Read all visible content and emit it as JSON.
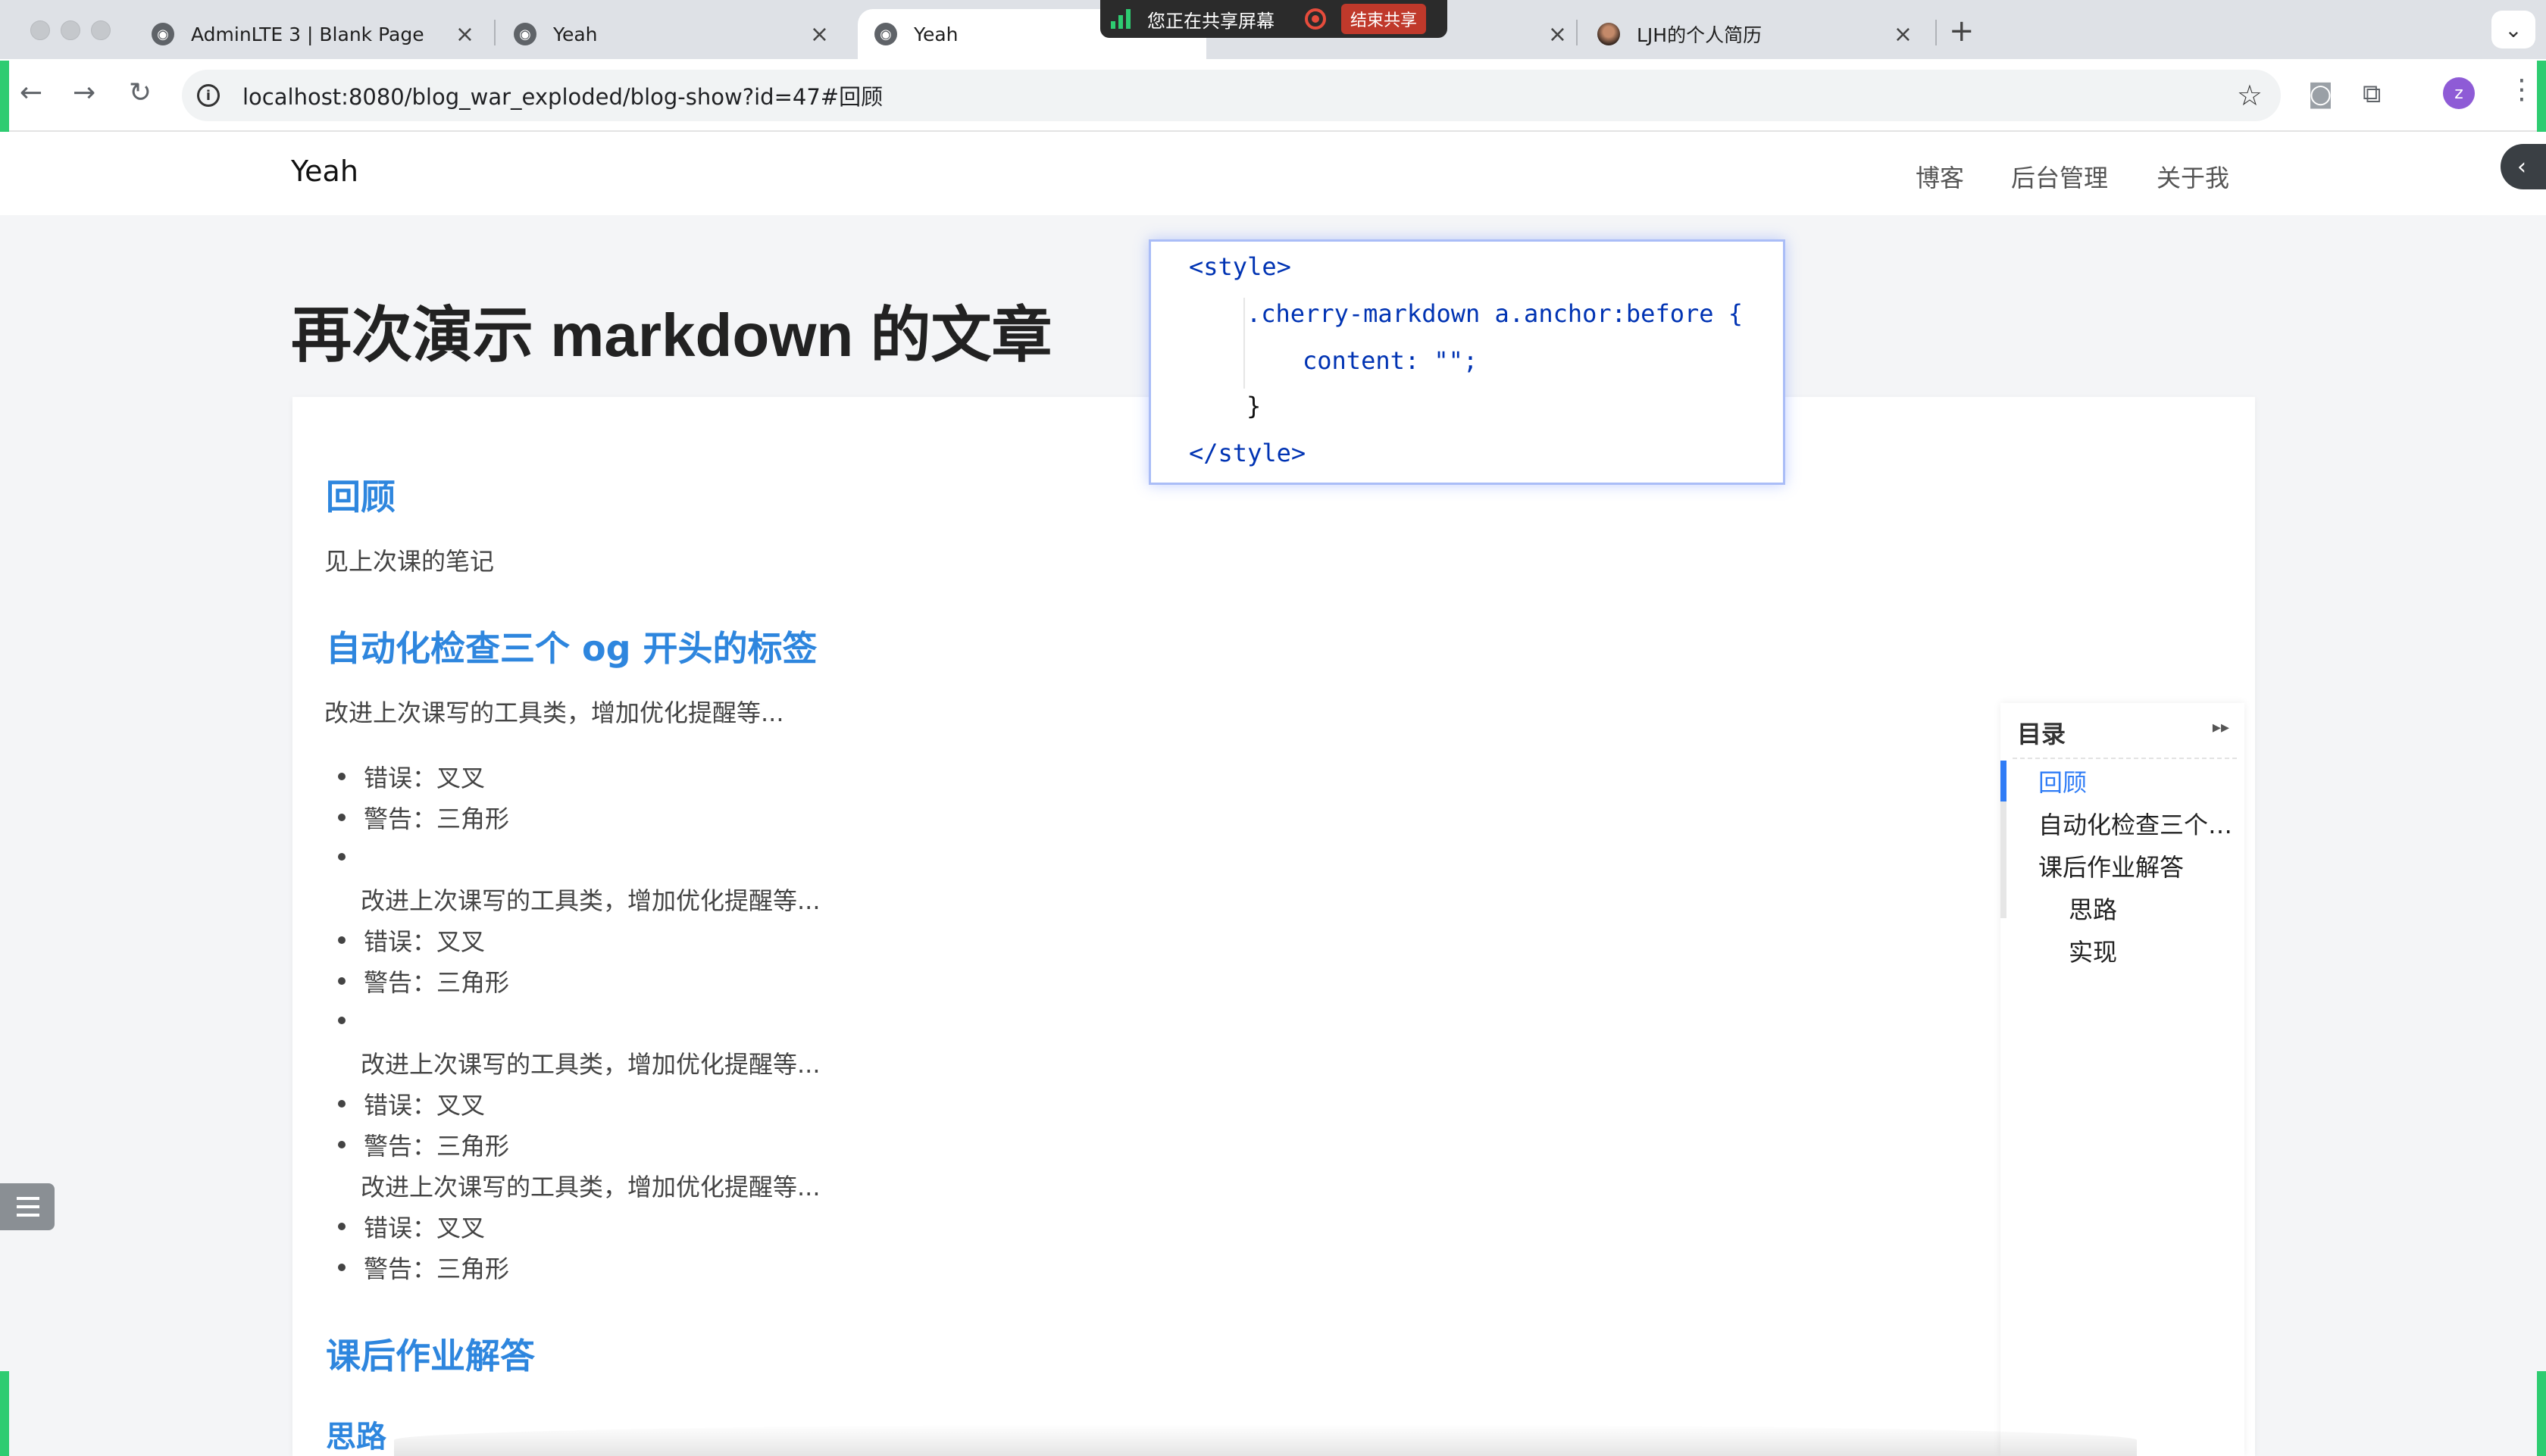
{
  "browser": {
    "tabs": [
      {
        "title": "AdminLTE 3 | Blank Page"
      },
      {
        "title": "Yeah"
      },
      {
        "title": "Yeah"
      },
      {
        "title": "LJH的个人简历"
      }
    ],
    "url": "localhost:8080/blog_war_exploded/blog-show?id=47#回顾",
    "avatar_letter": "z",
    "share": {
      "status": "您正在共享屏幕",
      "stop_label": "结束共享"
    }
  },
  "site": {
    "brand": "Yeah",
    "nav": [
      "博客",
      "后台管理",
      "关于我"
    ]
  },
  "post": {
    "title": "再次演示 markdown 的文章",
    "sections": {
      "review_heading": "回顾",
      "review_text": "见上次课的笔记",
      "og_heading": "自动化检查三个 og 开头的标签",
      "og_text": "改进上次课写的工具类，增加优化提醒等...",
      "homework_heading": "课后作业解答",
      "idea_heading": "思路"
    },
    "list": {
      "error": "错误：叉叉",
      "warning": "警告：三角形",
      "improve": "改进上次课写的工具类，增加优化提醒等..."
    }
  },
  "code_popup": {
    "lines": [
      "<style>",
      ".cherry-markdown a.anchor:before {",
      "content: \"\";",
      "}",
      "</style>"
    ]
  },
  "toc": {
    "title": "目录",
    "items": [
      "回顾",
      "自动化检查三个 og 开头的标签",
      "课后作业解答",
      "思路",
      "实现"
    ]
  },
  "colors": {
    "heading_blue": "#2e86de",
    "toc_active": "#2f7cf6",
    "share_green": "#2ecc71"
  }
}
